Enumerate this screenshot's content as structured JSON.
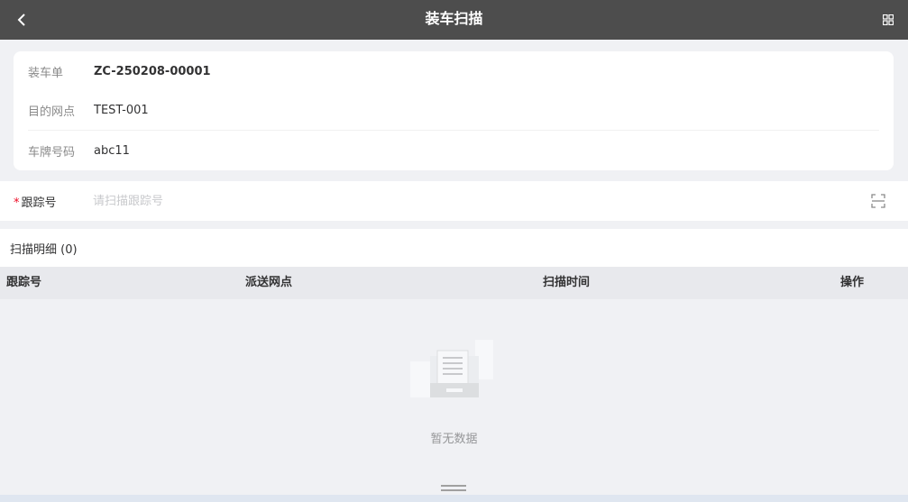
{
  "navbar": {
    "title": "装车扫描",
    "back_icon": "chevron-left-icon",
    "menu_icon": "grid-icon"
  },
  "info": {
    "rows": [
      {
        "label": "装车单",
        "value": "ZC-250208-00001"
      },
      {
        "label": "目的网点",
        "value": "TEST-001"
      },
      {
        "label": "车牌号码",
        "value": "abc11"
      }
    ]
  },
  "scan": {
    "required_mark": "*",
    "label": "跟踪号",
    "value": "",
    "placeholder": "请扫描跟踪号",
    "icon": "scan-icon"
  },
  "detail": {
    "title": "扫描明细 (0)"
  },
  "table": {
    "columns": [
      "跟踪号",
      "派送网点",
      "扫描时间",
      "操作"
    ],
    "rows": []
  },
  "empty": {
    "text": "暂无数据",
    "icon": "empty-document-icon"
  },
  "colors": {
    "navbar_bg": "#4d4d4d",
    "page_bg": "#f0f1f4",
    "required": "#ee0a24",
    "table_header_bg": "#e8e9ed"
  }
}
